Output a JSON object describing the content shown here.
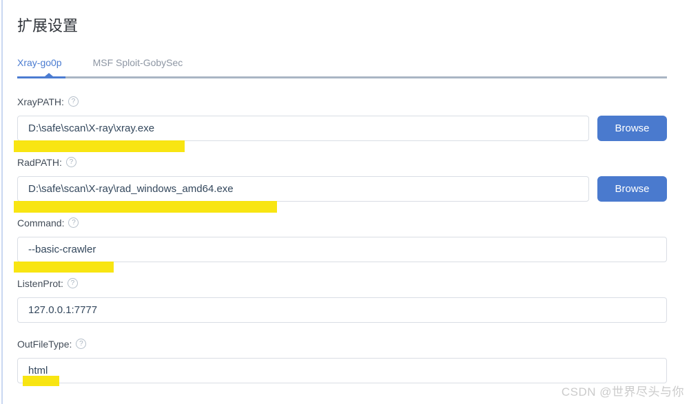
{
  "page": {
    "title": "扩展设置",
    "watermark": "CSDN @世界尽头与你"
  },
  "tabs": [
    {
      "label": "Xray-go0p",
      "active": true
    },
    {
      "label": "MSF Sploit-GobySec",
      "active": false
    }
  ],
  "icons": {
    "help": "?"
  },
  "form": {
    "browse_label": "Browse",
    "fields": [
      {
        "label": "XrayPATH:",
        "value": "D:\\safe\\scan\\X-ray\\xray.exe"
      },
      {
        "label": "RadPATH:",
        "value": "D:\\safe\\scan\\X-ray\\rad_windows_amd64.exe"
      },
      {
        "label": "Command:",
        "value": "--basic-crawler"
      },
      {
        "label": "ListenProt:",
        "value": "127.0.0.1:7777"
      },
      {
        "label": "OutFileType:",
        "value": "html"
      }
    ]
  },
  "colors": {
    "accent_blue": "#4a7ace",
    "tab_active": "#4b7cd1",
    "tab_inactive": "#8d96a3",
    "underline_gray": "#a9b5c4",
    "highlight_yellow": "#f7e300",
    "input_border": "#d9dde4",
    "input_text": "#33475c",
    "label_text": "#414b57",
    "watermark_gray": "#cbcbcb"
  }
}
